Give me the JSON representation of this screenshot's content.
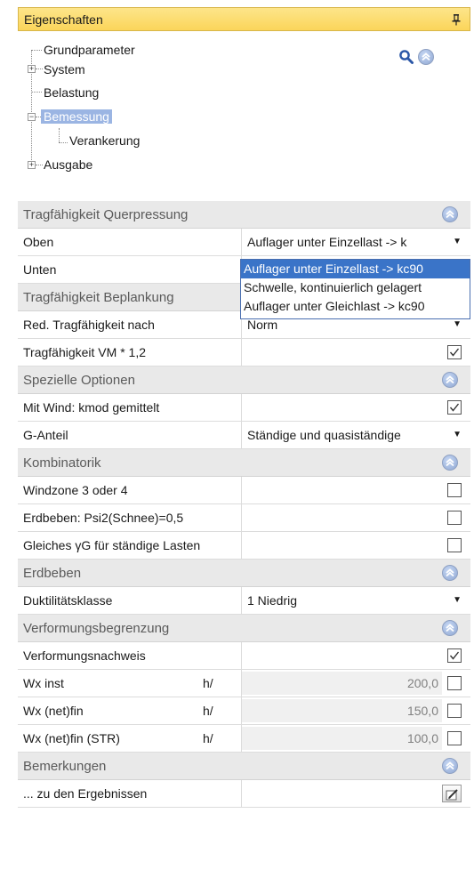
{
  "panel": {
    "title": "Eigenschaften"
  },
  "tree": {
    "items": [
      {
        "label": "Grundparameter"
      },
      {
        "label": "System"
      },
      {
        "label": "Belastung"
      },
      {
        "label": "Bemessung"
      },
      {
        "label": "Verankerung"
      },
      {
        "label": "Ausgabe"
      }
    ]
  },
  "grid": {
    "cat1": {
      "title": "Tragfähigkeit Querpressung"
    },
    "oben": {
      "label": "Oben",
      "value": "Auflager unter Einzellast -> k"
    },
    "unten": {
      "label": "Unten"
    },
    "cat2": {
      "title": "Tragfähigkeit Beplankung"
    },
    "red": {
      "label": "Red. Tragfähigkeit nach",
      "value": "Norm"
    },
    "vm": {
      "label": "Tragfähigkeit VM * 1,2",
      "checked": true
    },
    "cat3": {
      "title": "Spezielle Optionen"
    },
    "wind": {
      "label": "Mit Wind: kmod gemittelt",
      "checked": true
    },
    "ganteil": {
      "label": "G-Anteil",
      "value": "Ständige und quasiständige"
    },
    "cat4": {
      "title": "Kombinatorik"
    },
    "windzone": {
      "label": "Windzone 3 oder 4",
      "checked": false
    },
    "erdpsi": {
      "label": "Erdbeben: Psi2(Schnee)=0,5",
      "checked": false
    },
    "gleich": {
      "label": "Gleiches γG für ständige Lasten",
      "checked": false
    },
    "cat5": {
      "title": "Erdbeben"
    },
    "dukt": {
      "label": "Duktilitätsklasse",
      "value": "1 Niedrig"
    },
    "cat6": {
      "title": "Verformungsbegrenzung"
    },
    "verfnach": {
      "label": "Verformungsnachweis",
      "checked": true
    },
    "wxinst": {
      "label": "Wx inst",
      "unit": "h/",
      "value": "200,0",
      "checked": false
    },
    "wxnet": {
      "label": "Wx (net)fin",
      "unit": "h/",
      "value": "150,0",
      "checked": false
    },
    "wxstr": {
      "label": "Wx (net)fin (STR)",
      "unit": "h/",
      "value": "100,0",
      "checked": false
    },
    "cat7": {
      "title": "Bemerkungen"
    },
    "erg": {
      "label": "... zu den Ergebnissen"
    }
  },
  "dropdown": {
    "options": [
      "Auflager unter Einzellast -> kc90",
      "Schwelle, kontinuierlich gelagert",
      "Auflager unter Gleichlast -> kc90"
    ],
    "selected_index": 0
  },
  "colors": {
    "header": "#fbd55a",
    "selection": "#9bb5e3",
    "dropdown_highlight": "#3a74c8",
    "category_bg": "#e9e9e9"
  },
  "icons": [
    "pin-icon",
    "search-icon",
    "collapse-up-icon",
    "dropdown-arrow-icon",
    "checkbox-icon",
    "edit-icon"
  ]
}
